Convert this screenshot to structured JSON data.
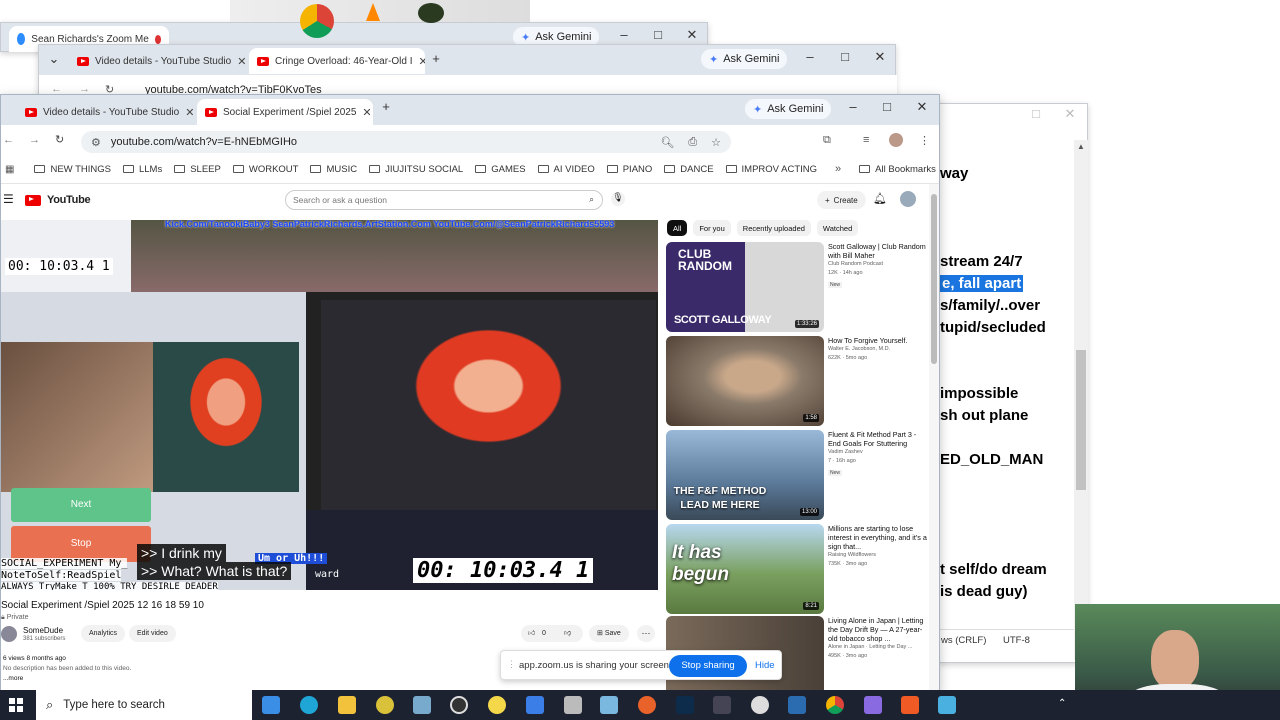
{
  "back_window": {
    "tab_title": "Sean Richards's Zoom Me",
    "ask_gemini": "Ask Gemini"
  },
  "mid_window": {
    "tabs": [
      {
        "title": "Video details - YouTube Studio"
      },
      {
        "title": "Cringe Overload: 46-Year-Old I"
      }
    ],
    "ask_gemini": "Ask Gemini",
    "url": "youtube.com/watch?v=TibF0KvoTes"
  },
  "browser": {
    "tabs": [
      {
        "title": "Video details - YouTube Studio"
      },
      {
        "title": "Social Experiment /Spiel 2025"
      }
    ],
    "new_tab": "+",
    "ask_gemini": "Ask Gemini",
    "url": "youtube.com/watch?v=E-hNEbMGIHo",
    "bookmarks": [
      "NEW THINGS",
      "LLMs",
      "SLEEP",
      "WORKOUT",
      "MUSIC",
      "JIUJITSU SOCIAL",
      "GAMES",
      "AI VIDEO",
      "PIANO",
      "DANCE",
      "IMPROV ACTING"
    ],
    "all_bookmarks": "All Bookmarks"
  },
  "youtube": {
    "logo": "YouTube",
    "search_placeholder": "Search or ask a question",
    "create": "Create",
    "chips": [
      "All",
      "For you",
      "Recently uploaded",
      "Watched"
    ],
    "video": {
      "overlay_banner": "Kick.Com/TanookiBaby3 SeanPatrickRichards.ArtStation.Com YouTube.Com/@SeanPatrickRichards5593",
      "timer_small": "00: 10:03.4 1",
      "timer_big": "00: 10:03.4 1",
      "captions": [
        ">> I drink my",
        ">> What? What is that?"
      ],
      "overlay_lines": [
        "SOCIAL_EXPERIMENT My_",
        "NoteToSelf:ReadSpiel",
        "ALWAYS TryMake T 100% TRY DESIRLE DEADER"
      ],
      "highlight": "Um or Uh!!!",
      "ward": "ward",
      "next_btn": "Next",
      "stop_btn": "Stop"
    },
    "title": "Social Experiment /Spiel 2025 12 16 18 59 10",
    "privacy": "Private",
    "channel": "SomeDude",
    "subscribers": "381 subscribers",
    "analytics": "Analytics",
    "edit_video": "Edit video",
    "likes": "0",
    "save": "Save",
    "views": "6 views  8 months ago",
    "description": "No description has been added to this video.",
    "more": "...more",
    "recommended": [
      {
        "title": "Scott Galloway | Club Random with Bill Maher",
        "channel": "Club Random Podcast",
        "meta": "12K · 14h ago",
        "badge": "New",
        "duration": "1:33:26",
        "thumb_text": "SCOTT GALLOWAY",
        "thumb_top": "CLUB RANDOM",
        "bg": "#3a2a6a"
      },
      {
        "title": "How To Forgive Yourself.",
        "channel": "Walter E. Jacobson, M.D.",
        "meta": "622K · 5mo ago",
        "badge": "",
        "duration": "1:58",
        "thumb_text": "",
        "thumb_top": "",
        "bg": "#8a7a6a"
      },
      {
        "title": "Fluent & Fit Method Part 3 - End Goals For Stuttering",
        "channel": "Vadim Zashev",
        "meta": "7 · 16h ago",
        "badge": "New",
        "duration": "13:00",
        "thumb_text": "THE F&F METHOD LEAD ME HERE",
        "thumb_top": "",
        "bg": "#6a8ab0"
      },
      {
        "title": "Millions are starting to lose interest in everything, and it's a sign that...",
        "channel": "Raising Wildflowers",
        "meta": "735K · 3mo ago",
        "badge": "",
        "duration": "8:21",
        "thumb_text": "It has begun",
        "thumb_top": "",
        "bg": "#7aa060"
      },
      {
        "title": "Living Alone in Japan | Letting the Day Drift By — A 27-year-old tobacco shop ...",
        "channel": "Alone in Japan · Letting the Day ...",
        "meta": "495K · 3mo ago",
        "badge": "",
        "duration": "",
        "thumb_text": "",
        "thumb_top": "",
        "bg": "#5a5048"
      }
    ]
  },
  "zoom_share": {
    "text": "app.zoom.us is sharing your screen.",
    "stop": "Stop sharing",
    "hide": "Hide"
  },
  "notepad": {
    "lines": [
      "way",
      "stream 24/7",
      "e, fall apart",
      "s/family/..over",
      "tupid/secluded",
      "impossible",
      "sh out plane",
      "ED_OLD_MAN",
      "t self/do dream",
      "is dead guy)"
    ],
    "status_crlf": "ws (CRLF)",
    "status_enc": "UTF-8"
  },
  "taskbar": {
    "search": "Type here to search"
  }
}
